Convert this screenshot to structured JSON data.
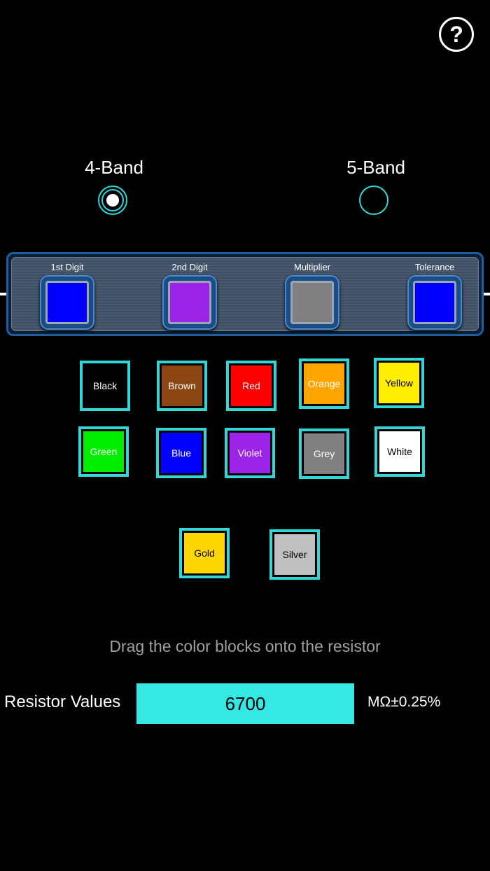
{
  "help": {
    "label": "?"
  },
  "band_options": [
    {
      "label": "4-Band",
      "selected": true
    },
    {
      "label": "5-Band",
      "selected": false
    }
  ],
  "resistor": {
    "slots": [
      {
        "label": "1st Digit",
        "color": "#0000ff"
      },
      {
        "label": "2nd Digit",
        "color": "#9b24e8"
      },
      {
        "label": "Multiplier",
        "color": "#808080"
      },
      {
        "label": "Tolerance",
        "color": "#0000ff"
      }
    ]
  },
  "color_blocks": [
    {
      "label": "Black",
      "color": "#000000",
      "text_color": "#ffffff"
    },
    {
      "label": "Brown",
      "color": "#8b4513",
      "text_color": "#ffffff"
    },
    {
      "label": "Red",
      "color": "#ff0000",
      "text_color": "#ffffff"
    },
    {
      "label": "Orange",
      "color": "#ffa500",
      "text_color": "#ffffff"
    },
    {
      "label": "Yellow",
      "color": "#ffee00",
      "text_color": "#000000"
    },
    {
      "label": "Green",
      "color": "#00ee00",
      "text_color": "#ffffff"
    },
    {
      "label": "Blue",
      "color": "#0000ff",
      "text_color": "#ffffff"
    },
    {
      "label": "Violet",
      "color": "#9b24e8",
      "text_color": "#ffffff"
    },
    {
      "label": "Grey",
      "color": "#808080",
      "text_color": "#ffffff"
    },
    {
      "label": "White",
      "color": "#ffffff",
      "text_color": "#000000"
    },
    {
      "label": "Gold",
      "color": "#ffd700",
      "text_color": "#000000"
    },
    {
      "label": "Silver",
      "color": "#c0c0c0",
      "text_color": "#000000"
    }
  ],
  "hint": "Drag the color blocks onto the resistor",
  "result": {
    "label": "Resistor Values",
    "value": "6700",
    "unit": "MΩ±0.25%"
  },
  "accent_color": "#35e8e3"
}
